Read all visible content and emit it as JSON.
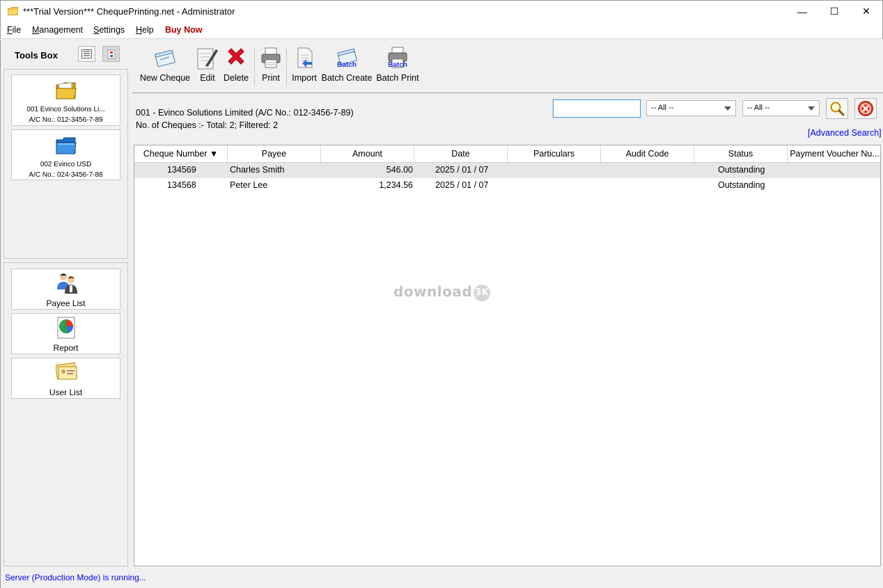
{
  "window": {
    "title": "***Trial Version*** ChequePrinting.net - Administrator",
    "min_glyph": "—",
    "max_glyph": "☐",
    "close_glyph": "✕"
  },
  "menu": [
    {
      "first": "F",
      "rest": "ile"
    },
    {
      "first": "M",
      "rest": "anagement"
    },
    {
      "first": "S",
      "rest": "ettings"
    },
    {
      "first": "H",
      "rest": "elp"
    },
    {
      "label": "Buy Now"
    }
  ],
  "tools_box": {
    "title": "Tools Box",
    "accounts": [
      {
        "name": "001 Evinco Solutions Li...",
        "acno": "A/C No.: 012-3456-7-89",
        "icon": "folder-open-yellow-icon"
      },
      {
        "name": "002 Evinco USD",
        "acno": "A/C No.: 024-3456-7-88",
        "icon": "folder-blue-icon"
      }
    ],
    "tools": [
      {
        "label": "Payee List",
        "icon": "people-icon"
      },
      {
        "label": "Report",
        "icon": "report-chart-icon"
      },
      {
        "label": "User List",
        "icon": "user-card-icon"
      }
    ]
  },
  "toolbar": {
    "new_cheque": "New Cheque",
    "edit": "Edit",
    "delete": "Delete",
    "print": "Print",
    "import": "Import",
    "batch_create": "Batch Create",
    "batch_print": "Batch Print",
    "batch_badge": "Batch"
  },
  "account_info": "001 - Evinco Solutions Limited (A/C No.: 012-3456-7-89)",
  "count_info": "No. of Cheques :- Total: 2; Filtered: 2",
  "filters": {
    "search_value": "",
    "filter1": "-- All --",
    "filter2": "-- All --"
  },
  "advanced_search": "[Advanced Search]",
  "table": {
    "columns": [
      "Cheque Number ▼",
      "Payee",
      "Amount",
      "Date",
      "Particulars",
      "Audit Code",
      "Status",
      "Payment Voucher Nu..."
    ],
    "rows": [
      {
        "cheque": "134569",
        "payee": "Charles Smith",
        "amount": "546.00",
        "date": "2025 / 01 / 07",
        "particulars": "",
        "audit": "",
        "status": "Outstanding",
        "voucher": ""
      },
      {
        "cheque": "134568",
        "payee": "Peter Lee",
        "amount": "1,234.56",
        "date": "2025 / 01 / 07",
        "particulars": "",
        "audit": "",
        "status": "Outstanding",
        "voucher": ""
      }
    ]
  },
  "watermark": {
    "text": "download",
    "badge": "3K"
  },
  "status_bar": "Server (Production Mode) is running..."
}
